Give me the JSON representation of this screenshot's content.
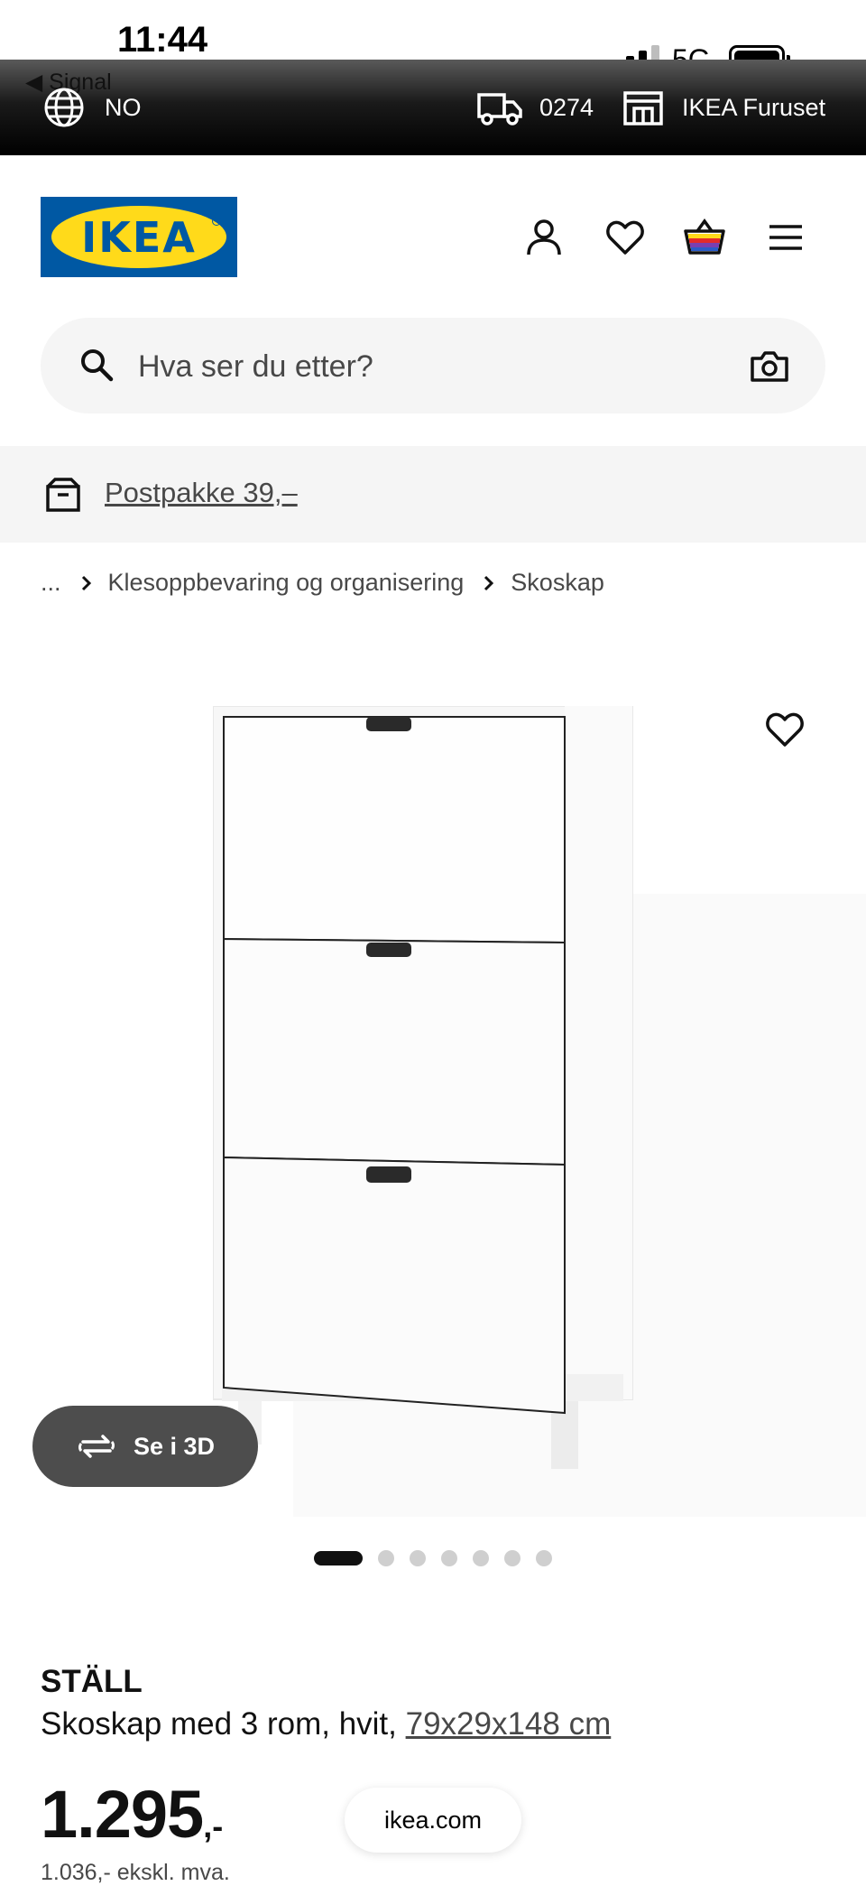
{
  "status_bar": {
    "time": "11:44",
    "back_app": "◀ Signal",
    "network": "5G"
  },
  "top_bar": {
    "country": "NO",
    "postcode": "0274",
    "store": "IKEA Furuset"
  },
  "header": {
    "logo_text": "IKEA",
    "icons": [
      "profile-icon",
      "heart-icon",
      "basket-icon",
      "menu-icon"
    ]
  },
  "search": {
    "placeholder": "Hva ser du etter?"
  },
  "promo": {
    "text": "Postpakke 39,–"
  },
  "breadcrumb": {
    "ellipsis": "...",
    "items": [
      "Klesoppbevaring og organisering",
      "Skoskap"
    ]
  },
  "gallery": {
    "button_3d": "Se i 3D",
    "image_count": 7,
    "active_index": 0
  },
  "product": {
    "name": "STÄLL",
    "description": "Skoskap med 3 rom, hvit, ",
    "dimensions": "79x29x148 cm",
    "price_main": "1.295",
    "price_cents": ",-",
    "price_ex_vat": "1.036,- ekskl. mva."
  },
  "browser": {
    "url": "ikea.com"
  },
  "colors": {
    "logo_blue": "#0058a3",
    "logo_yellow": "#ffda1a",
    "top_bar": "#000000"
  }
}
